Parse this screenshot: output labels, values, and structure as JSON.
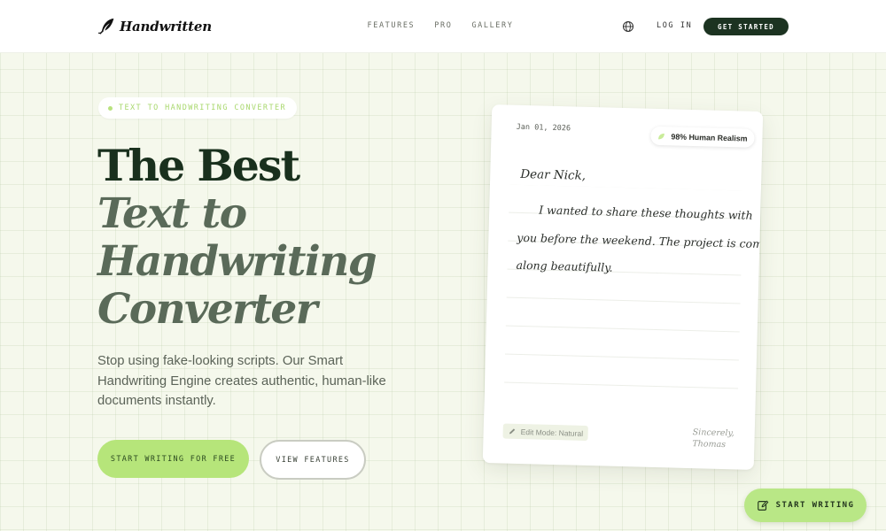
{
  "nav": {
    "brand": "Handwritten",
    "links": [
      "FEATURES",
      "PRO",
      "GALLERY"
    ],
    "language_icon": "globe-icon",
    "login": "LOG IN",
    "get_started": "GET STARTED"
  },
  "hero": {
    "eyebrow": "TEXT TO HANDWRITING CONVERTER",
    "title_line1": "The Best",
    "title_line2": "Text to",
    "title_line3": "Handwriting",
    "title_line4": "Converter",
    "subtitle": "Stop using fake-looking scripts. Our Smart Handwriting Engine creates authentic, human-like documents instantly.",
    "cta_primary": "START WRITING FOR FREE",
    "cta_secondary": "VIEW FEATURES"
  },
  "note": {
    "date": "Jan 01, 2026",
    "realism_badge": "98% Human Realism",
    "greeting": "Dear Nick,",
    "line1": "I wanted to share these thoughts with",
    "line2": "you before the weekend. The project is coming",
    "line3": "along beautifully.",
    "edit_mode": "Edit Mode: Natural",
    "sign_off": "Sincerely,",
    "signature": "Thomas"
  },
  "floating_button": {
    "label": "START WRITING",
    "icon": "edit-icon"
  },
  "colors": {
    "accent_green": "#b6e57a",
    "dark_green": "#1c3321",
    "background": "#f5f8ec"
  }
}
